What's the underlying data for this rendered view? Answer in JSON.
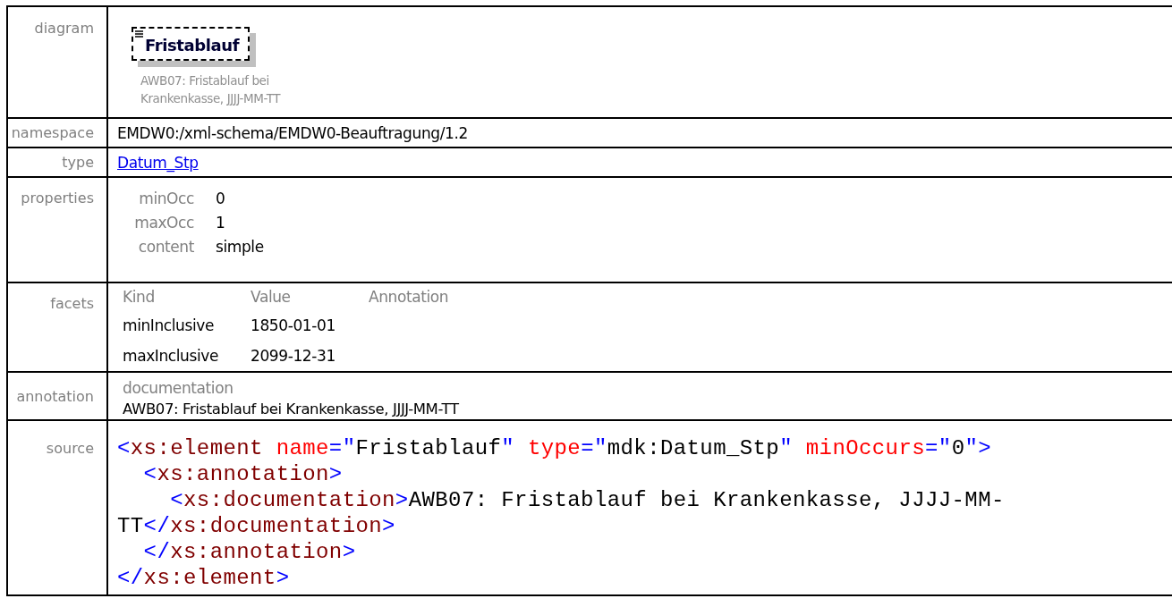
{
  "diagram": {
    "label": "diagram",
    "element_name": "Fristablauf",
    "caption_lines": [
      "AWB07: Fristablauf bei",
      "Krankenkasse, JJJJ-MM-TT"
    ]
  },
  "namespace": {
    "label": "namespace",
    "value": "EMDW0:/xml-schema/EMDW0-Beauftragung/1.2"
  },
  "type": {
    "label": "type",
    "value": "Datum_Stp"
  },
  "properties": {
    "label": "properties",
    "items": [
      {
        "name": "minOcc",
        "value": "0"
      },
      {
        "name": "maxOcc",
        "value": "1"
      },
      {
        "name": "content",
        "value": "simple"
      }
    ]
  },
  "facets": {
    "label": "facets",
    "columns": [
      "Kind",
      "Value",
      "Annotation"
    ],
    "rows": [
      [
        "minInclusive",
        "1850-01-01"
      ],
      [
        "maxInclusive",
        "2099-12-31"
      ]
    ]
  },
  "annotation": {
    "label": "annotation",
    "heading": "documentation",
    "text": "AWB07: Fristablauf bei Krankenkasse, JJJJ-MM-TT"
  },
  "source": {
    "label": "source",
    "lines": [
      [
        {
          "kind": "punct",
          "text": "<"
        },
        {
          "kind": "tag",
          "text": "xs:element"
        },
        {
          "kind": "attr",
          "text": " name"
        },
        {
          "kind": "punct",
          "text": "=\""
        },
        {
          "kind": "text",
          "text": "Fristablauf"
        },
        {
          "kind": "punct",
          "text": "\""
        },
        {
          "kind": "attr",
          "text": " type"
        },
        {
          "kind": "punct",
          "text": "=\""
        },
        {
          "kind": "text",
          "text": "mdk:Datum_Stp"
        },
        {
          "kind": "punct",
          "text": "\""
        },
        {
          "kind": "attr",
          "text": " minOccurs"
        },
        {
          "kind": "punct",
          "text": "=\""
        },
        {
          "kind": "text",
          "text": "0"
        },
        {
          "kind": "punct",
          "text": "\">"
        }
      ],
      [
        {
          "kind": "punct",
          "text": "  <"
        },
        {
          "kind": "tag",
          "text": "xs:annotation"
        },
        {
          "kind": "punct",
          "text": ">"
        }
      ],
      [
        {
          "kind": "punct",
          "text": "    <"
        },
        {
          "kind": "tag",
          "text": "xs:documentation"
        },
        {
          "kind": "punct",
          "text": ">"
        },
        {
          "kind": "text",
          "text": "AWB07: Fristablauf bei Krankenkasse, JJJJ-MM-"
        }
      ],
      [
        {
          "kind": "text",
          "text": "TT"
        },
        {
          "kind": "punct",
          "text": "</"
        },
        {
          "kind": "tag",
          "text": "xs:documentation"
        },
        {
          "kind": "punct",
          "text": ">"
        }
      ],
      [
        {
          "kind": "punct",
          "text": "  </"
        },
        {
          "kind": "tag",
          "text": "xs:annotation"
        },
        {
          "kind": "punct",
          "text": ">"
        }
      ],
      [
        {
          "kind": "punct",
          "text": "</"
        },
        {
          "kind": "tag",
          "text": "xs:element"
        },
        {
          "kind": "punct",
          "text": ">"
        }
      ]
    ]
  }
}
